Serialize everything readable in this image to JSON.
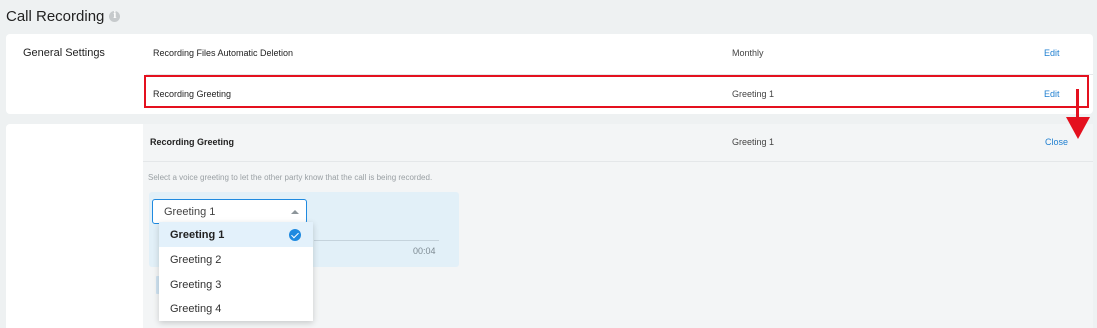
{
  "page": {
    "title": "Call Recording",
    "info_glyph": "i"
  },
  "general": {
    "label": "General Settings",
    "rows": [
      {
        "name": "Recording Files Automatic Deletion",
        "value": "Monthly",
        "action": "Edit"
      },
      {
        "name": "Recording Greeting",
        "value": "Greeting 1",
        "action": "Edit"
      }
    ]
  },
  "greeting_panel": {
    "title": "Recording Greeting",
    "value": "Greeting 1",
    "close": "Close",
    "description": "Select a voice greeting to let the other party know that the call is being recorded.",
    "player": {
      "time": "00:04"
    },
    "select": {
      "value": "Greeting 1",
      "options": [
        "Greeting 1",
        "Greeting 2",
        "Greeting 3",
        "Greeting 4"
      ],
      "selected_index": 0
    }
  },
  "colors": {
    "accent": "#1f7fd0",
    "highlight": "#e4101e",
    "background": "#eef1f2",
    "player_bg": "#e2f0f8"
  }
}
